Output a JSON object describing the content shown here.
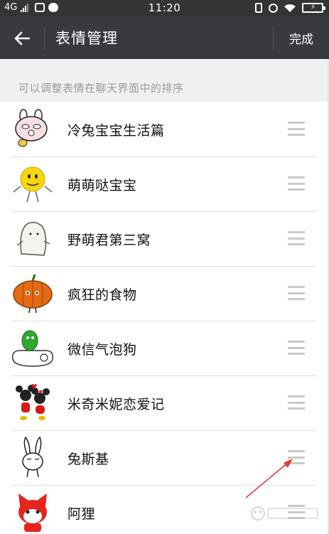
{
  "status_bar": {
    "network": "4G",
    "time": "11:20"
  },
  "header": {
    "title": "表情管理",
    "done_label": "完成"
  },
  "hint": "可以调整表情在聊天界面中的排序",
  "stickers": [
    {
      "name": "冷兔宝宝生活篇",
      "icon": "bunny-sticker-icon"
    },
    {
      "name": "萌萌哒宝宝",
      "icon": "smiley-sticker-icon"
    },
    {
      "name": "野萌君第三窝",
      "icon": "ghost-sticker-icon"
    },
    {
      "name": "疯狂的食物",
      "icon": "pumpkin-sticker-icon"
    },
    {
      "name": "微信气泡狗",
      "icon": "bubble-dog-sticker-icon"
    },
    {
      "name": "米奇米妮恋爱记",
      "icon": "mickey-minnie-sticker-icon"
    },
    {
      "name": "兔斯基",
      "icon": "tuzki-sticker-icon"
    },
    {
      "name": "阿狸",
      "icon": "ali-fox-sticker-icon"
    }
  ],
  "colors": {
    "status_bar_bg": "#343434",
    "title_bar_bg": "#393a3f",
    "page_bg": "#f0f0f0",
    "hint_text": "#9a9a9a",
    "handle": "#c9c9c9",
    "annotation_arrow": "#e53935"
  }
}
